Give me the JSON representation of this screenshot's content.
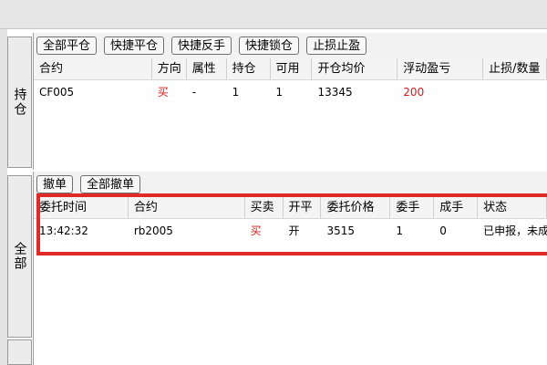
{
  "side_tabs": {
    "positions": "持仓",
    "all": "全部"
  },
  "positions_toolbar": {
    "close_all": "全部平仓",
    "quick_close": "快捷平仓",
    "quick_reverse": "快捷反手",
    "quick_lock": "快捷锁仓",
    "stop_loss_profit": "止损止盈"
  },
  "positions_table": {
    "columns": [
      "合约",
      "方向",
      "属性",
      "持仓",
      "可用",
      "开仓均价",
      "浮动盈亏",
      "止损/数量"
    ],
    "rows": [
      {
        "contract": "CF005",
        "direction": "买",
        "attribute": "-",
        "position": "1",
        "available": "1",
        "avg_open_price": "13345",
        "floating_pnl": "200",
        "stop_qty": ""
      }
    ]
  },
  "orders_toolbar": {
    "cancel": "撤单",
    "cancel_all": "全部撤单"
  },
  "orders_table": {
    "columns": [
      "委托时间",
      "合约",
      "买卖",
      "开平",
      "委托价格",
      "委手",
      "成手",
      "状态"
    ],
    "rows": [
      {
        "time": "13:42:32",
        "contract": "rb2005",
        "side": "买",
        "open_close": "开",
        "price": "3515",
        "qty": "1",
        "filled": "0",
        "status": "已申报，未成交"
      }
    ]
  },
  "colors": {
    "buy": "#d31b1b",
    "pnl_positive": "#d31b1b",
    "highlight_box": "#e02a2a"
  }
}
